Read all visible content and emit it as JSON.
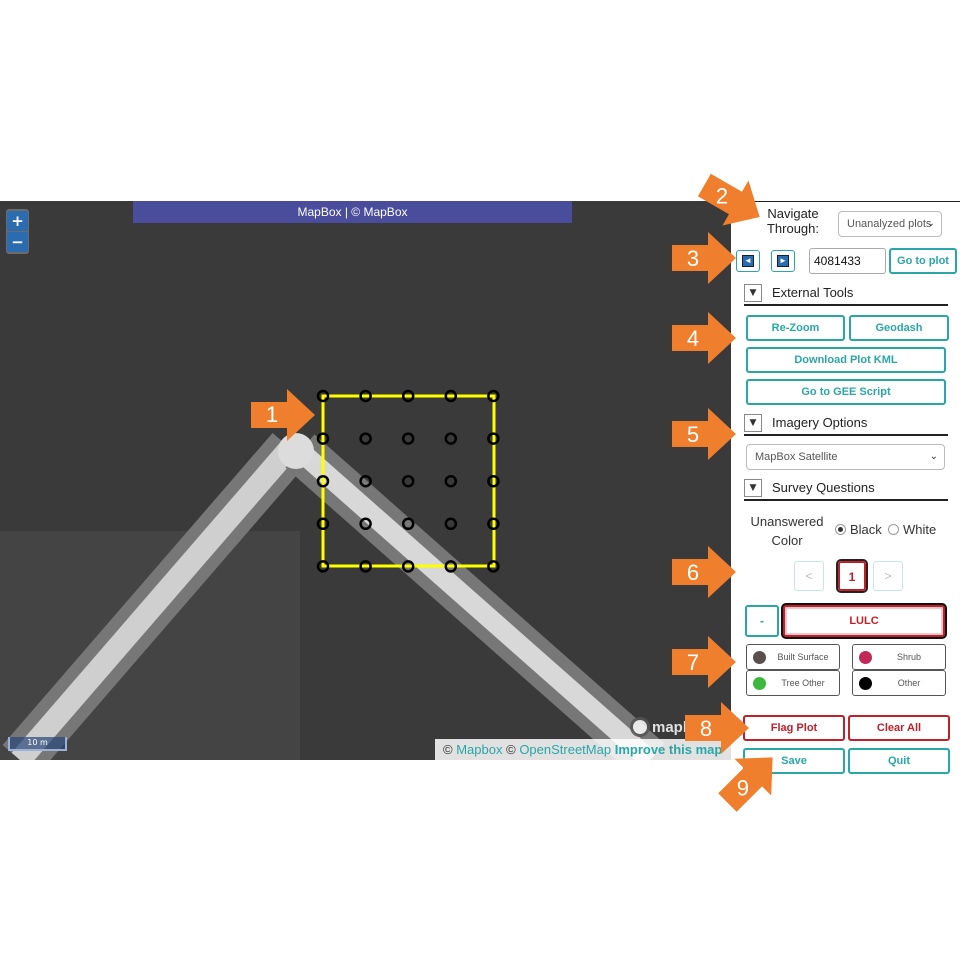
{
  "map": {
    "zoom_in": "+",
    "zoom_out": "−",
    "imagery_banner": "MapBox | © MapBox",
    "scale_label": "10 m",
    "logo_text": "mapbox",
    "attribution": {
      "copyright_1": "©",
      "mapbox_link": "Mapbox",
      "copyright_2": "©",
      "osm_link": "OpenStreetMap",
      "improve_link": "Improve this map"
    }
  },
  "panel": {
    "navigate_label": "Navigate Through:",
    "navigate_select": "Unanalyzed plots",
    "prev_icon": "◄",
    "next_icon": "►",
    "plot_id": "4081433",
    "go_to_plot": "Go to plot",
    "external_tools": {
      "title": "External Tools",
      "rezoom": "Re-Zoom",
      "geodash": "Geodash",
      "download_kml": "Download Plot KML",
      "gee_script": "Go to GEE Script"
    },
    "imagery_options": {
      "title": "Imagery Options",
      "selected": "MapBox Satellite"
    },
    "survey_questions": {
      "title": "Survey Questions",
      "unanswered_color_label": "Unanswered Color",
      "radio_black": "Black",
      "radio_white": "White",
      "prev_page": "<",
      "current_page": "1",
      "next_page": ">",
      "minus": "-",
      "question": "LULC",
      "answers": [
        {
          "label": "Built Surface",
          "color": "#5a4e4e"
        },
        {
          "label": "Shrub",
          "color": "#c0285a"
        },
        {
          "label": "Tree Other",
          "color": "#3cb83c"
        },
        {
          "label": "Other",
          "color": "#000000"
        }
      ]
    },
    "flag_plot": "Flag Plot",
    "clear_all": "Clear All",
    "save": "Save",
    "quit": "Quit"
  },
  "callouts": [
    "1",
    "2",
    "3",
    "4",
    "5",
    "6",
    "7",
    "8",
    "9"
  ],
  "colors": {
    "accent": "#2ba6a6",
    "danger": "#c0202a",
    "plot_outline": "#ffff00",
    "callout": "#ef7f2c"
  }
}
